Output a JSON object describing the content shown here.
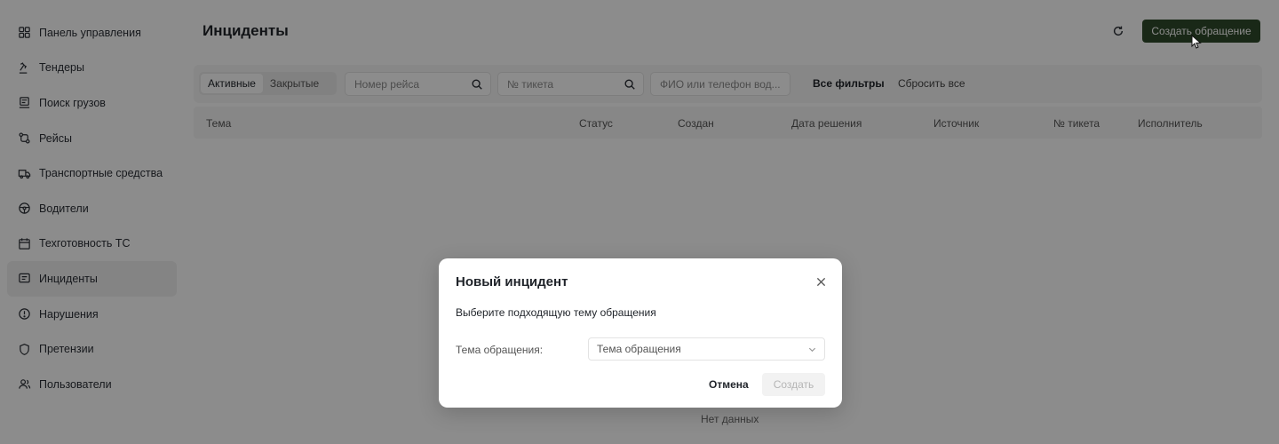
{
  "sidebar": {
    "items": [
      {
        "label": "Панель управления",
        "icon": "dashboard-icon",
        "active": false
      },
      {
        "label": "Тендеры",
        "icon": "gavel-icon",
        "active": false
      },
      {
        "label": "Поиск грузов",
        "icon": "search-cargo-icon",
        "active": false
      },
      {
        "label": "Рейсы",
        "icon": "route-icon",
        "active": false
      },
      {
        "label": "Транспортные средства",
        "icon": "truck-icon",
        "active": false
      },
      {
        "label": "Водители",
        "icon": "steering-wheel-icon",
        "active": false
      },
      {
        "label": "Техготовность ТС",
        "icon": "calendar-icon",
        "active": false
      },
      {
        "label": "Инциденты",
        "icon": "message-icon",
        "active": true
      },
      {
        "label": "Нарушения",
        "icon": "alert-icon",
        "active": false
      },
      {
        "label": "Претензии",
        "icon": "shield-icon",
        "active": false
      },
      {
        "label": "Пользователи",
        "icon": "users-icon",
        "active": false
      }
    ]
  },
  "header": {
    "title": "Инциденты",
    "refresh_icon": "refresh-icon",
    "create_label": "Создать обращение"
  },
  "filters": {
    "tabs": [
      {
        "label": "Активные",
        "active": true
      },
      {
        "label": "Закрытые",
        "active": false
      }
    ],
    "flight_placeholder": "Номер рейса",
    "ticket_placeholder": "№ тикета",
    "driver_placeholder": "ФИО или телефон вод...",
    "all_filters_label": "Все фильтры",
    "reset_label": "Сбросить все"
  },
  "table": {
    "columns": [
      "Тема",
      "Статус",
      "Создан",
      "Дата решения",
      "Источник",
      "№ тикета",
      "Исполнитель"
    ],
    "empty_text": "Нет данных"
  },
  "modal": {
    "title": "Новый инцидент",
    "subtitle": "Выберите подходящую тему обращения",
    "field_label": "Тема обращения:",
    "select_placeholder": "Тема обращения",
    "cancel_label": "Отмена",
    "submit_label": "Создать"
  },
  "colors": {
    "accent": "#2f4a2a",
    "overlay": "rgba(0,0,0,0.45)"
  }
}
